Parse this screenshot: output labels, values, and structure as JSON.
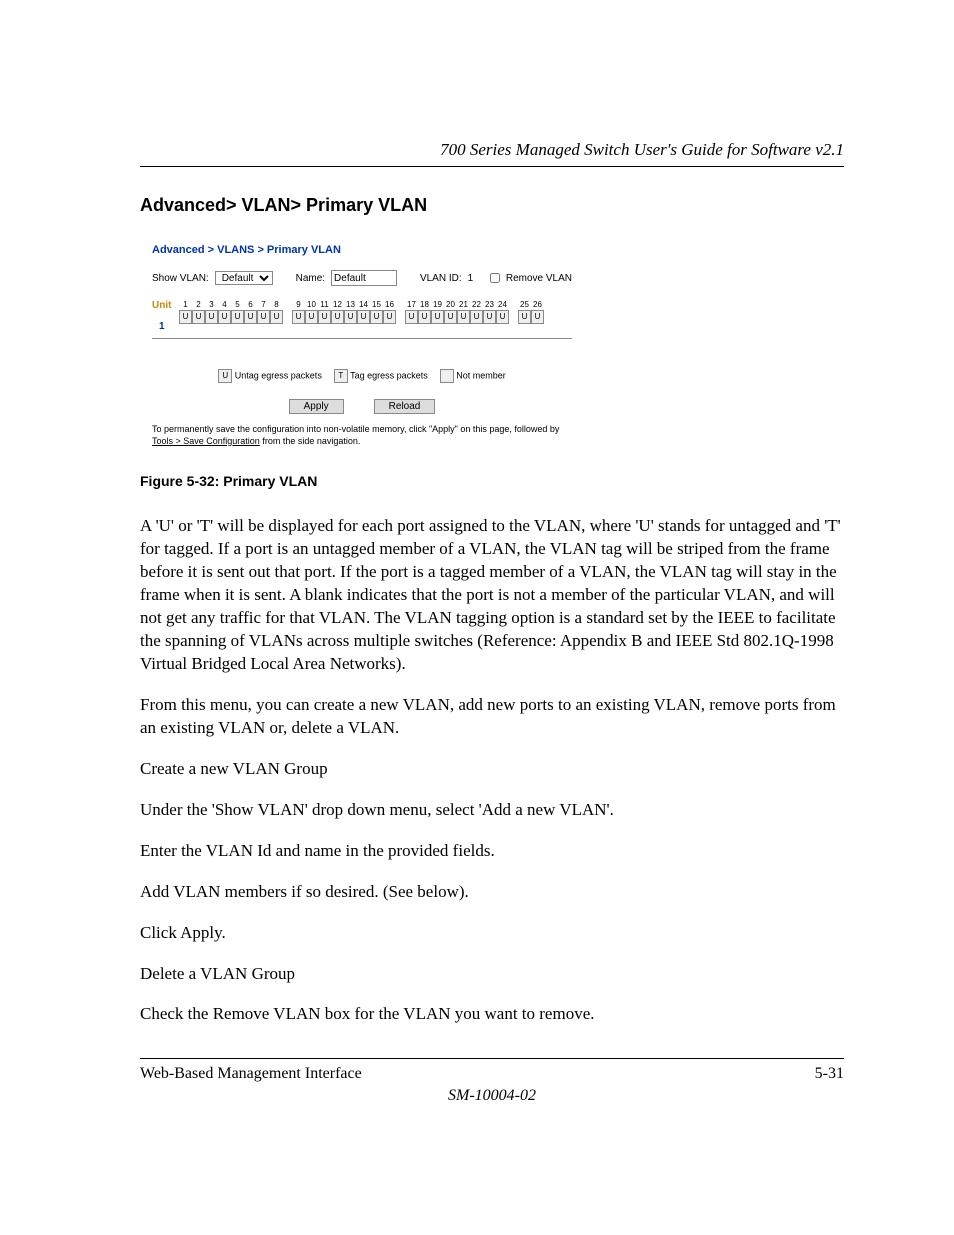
{
  "header": {
    "guide_title": "700 Series Managed Switch User's Guide for Software v2.1"
  },
  "section": {
    "title": "Advanced> VLAN> Primary VLAN"
  },
  "screenshot": {
    "breadcrumb": "Advanced > VLANS > Primary VLAN",
    "show_vlan_label": "Show VLAN:",
    "show_vlan_value": "Default",
    "name_label": "Name:",
    "name_value": "Default",
    "vlan_id_label": "VLAN ID:",
    "vlan_id_value": "1",
    "remove_vlan_label": "Remove VLAN",
    "unit_label": "Unit",
    "unit_number": "1",
    "port_groups": [
      [
        1,
        2,
        3,
        4,
        5,
        6,
        7,
        8
      ],
      [
        9,
        10,
        11,
        12,
        13,
        14,
        15,
        16
      ],
      [
        17,
        18,
        19,
        20,
        21,
        22,
        23,
        24
      ],
      [
        25,
        26
      ]
    ],
    "port_state": "U",
    "legend": {
      "untag": "Untag egress packets",
      "tag": "Tag egress packets",
      "not_member": "Not member",
      "u_mark": "U",
      "t_mark": "T",
      "blank_mark": ""
    },
    "apply_btn": "Apply",
    "reload_btn": "Reload",
    "note_prefix": "To permanently save the configuration into non-volatile memory, click \"Apply\" on this page, followed by ",
    "note_link": "Tools > Save Configuration",
    "note_suffix": " from the side navigation."
  },
  "figure_caption": "Figure 5-32:  Primary VLAN",
  "body": {
    "p1": "A 'U' or 'T' will be displayed for each port assigned to the VLAN, where 'U' stands for untagged and 'T' for tagged. If a port is an untagged member of a VLAN, the VLAN tag will be striped from the frame before it is sent out that port.  If the port is a tagged member of a VLAN, the VLAN tag will stay in the frame when it is sent.  A blank indicates that the port is not a member of the particular VLAN, and will not get any traffic for that VLAN. The VLAN tagging option is a standard set by the IEEE to facilitate the spanning of VLANs across multiple switches (Reference: Appendix B and IEEE Std 802.1Q-1998 Virtual Bridged Local Area Networks).",
    "p2": "From this menu, you can create a new VLAN, add new ports to an existing VLAN, remove ports from an existing VLAN or, delete a VLAN.",
    "p3": "Create a new VLAN Group",
    "p4": "Under the 'Show VLAN' drop down menu, select 'Add a new VLAN'.",
    "p5": "Enter the VLAN Id and name in the provided fields.",
    "p6": "Add VLAN members if so desired. (See below).",
    "p7": "Click Apply.",
    "p8": "Delete a VLAN Group",
    "p9": "Check the Remove VLAN box for the VLAN you want to remove."
  },
  "footer": {
    "left": "Web-Based Management Interface",
    "right": "5-31",
    "doc": "SM-10004-02"
  }
}
